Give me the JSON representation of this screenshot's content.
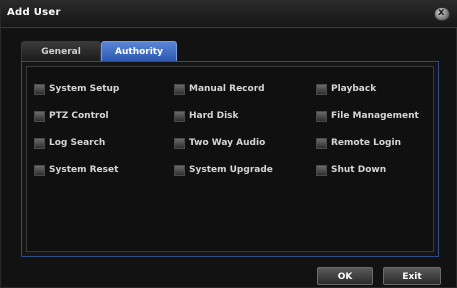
{
  "dialog": {
    "title": "Add User",
    "close_glyph": "x"
  },
  "tabs": [
    {
      "label": "General",
      "selected": false
    },
    {
      "label": "Authority",
      "selected": true
    }
  ],
  "permissions": [
    {
      "label": "System Setup",
      "checked": false
    },
    {
      "label": "Manual Record",
      "checked": false
    },
    {
      "label": "Playback",
      "checked": false
    },
    {
      "label": "PTZ Control",
      "checked": false
    },
    {
      "label": "Hard Disk",
      "checked": false
    },
    {
      "label": "File Management",
      "checked": false
    },
    {
      "label": "Log Search",
      "checked": false
    },
    {
      "label": "Two Way Audio",
      "checked": false
    },
    {
      "label": "Remote Login",
      "checked": false
    },
    {
      "label": "System Reset",
      "checked": false
    },
    {
      "label": "System Upgrade",
      "checked": false
    },
    {
      "label": "Shut Down",
      "checked": false
    }
  ],
  "buttons": {
    "ok_label": "OK",
    "exit_label": "Exit"
  },
  "colors": {
    "selected_tab": "#2c58b3",
    "panel_border": "#2d4c8a"
  }
}
